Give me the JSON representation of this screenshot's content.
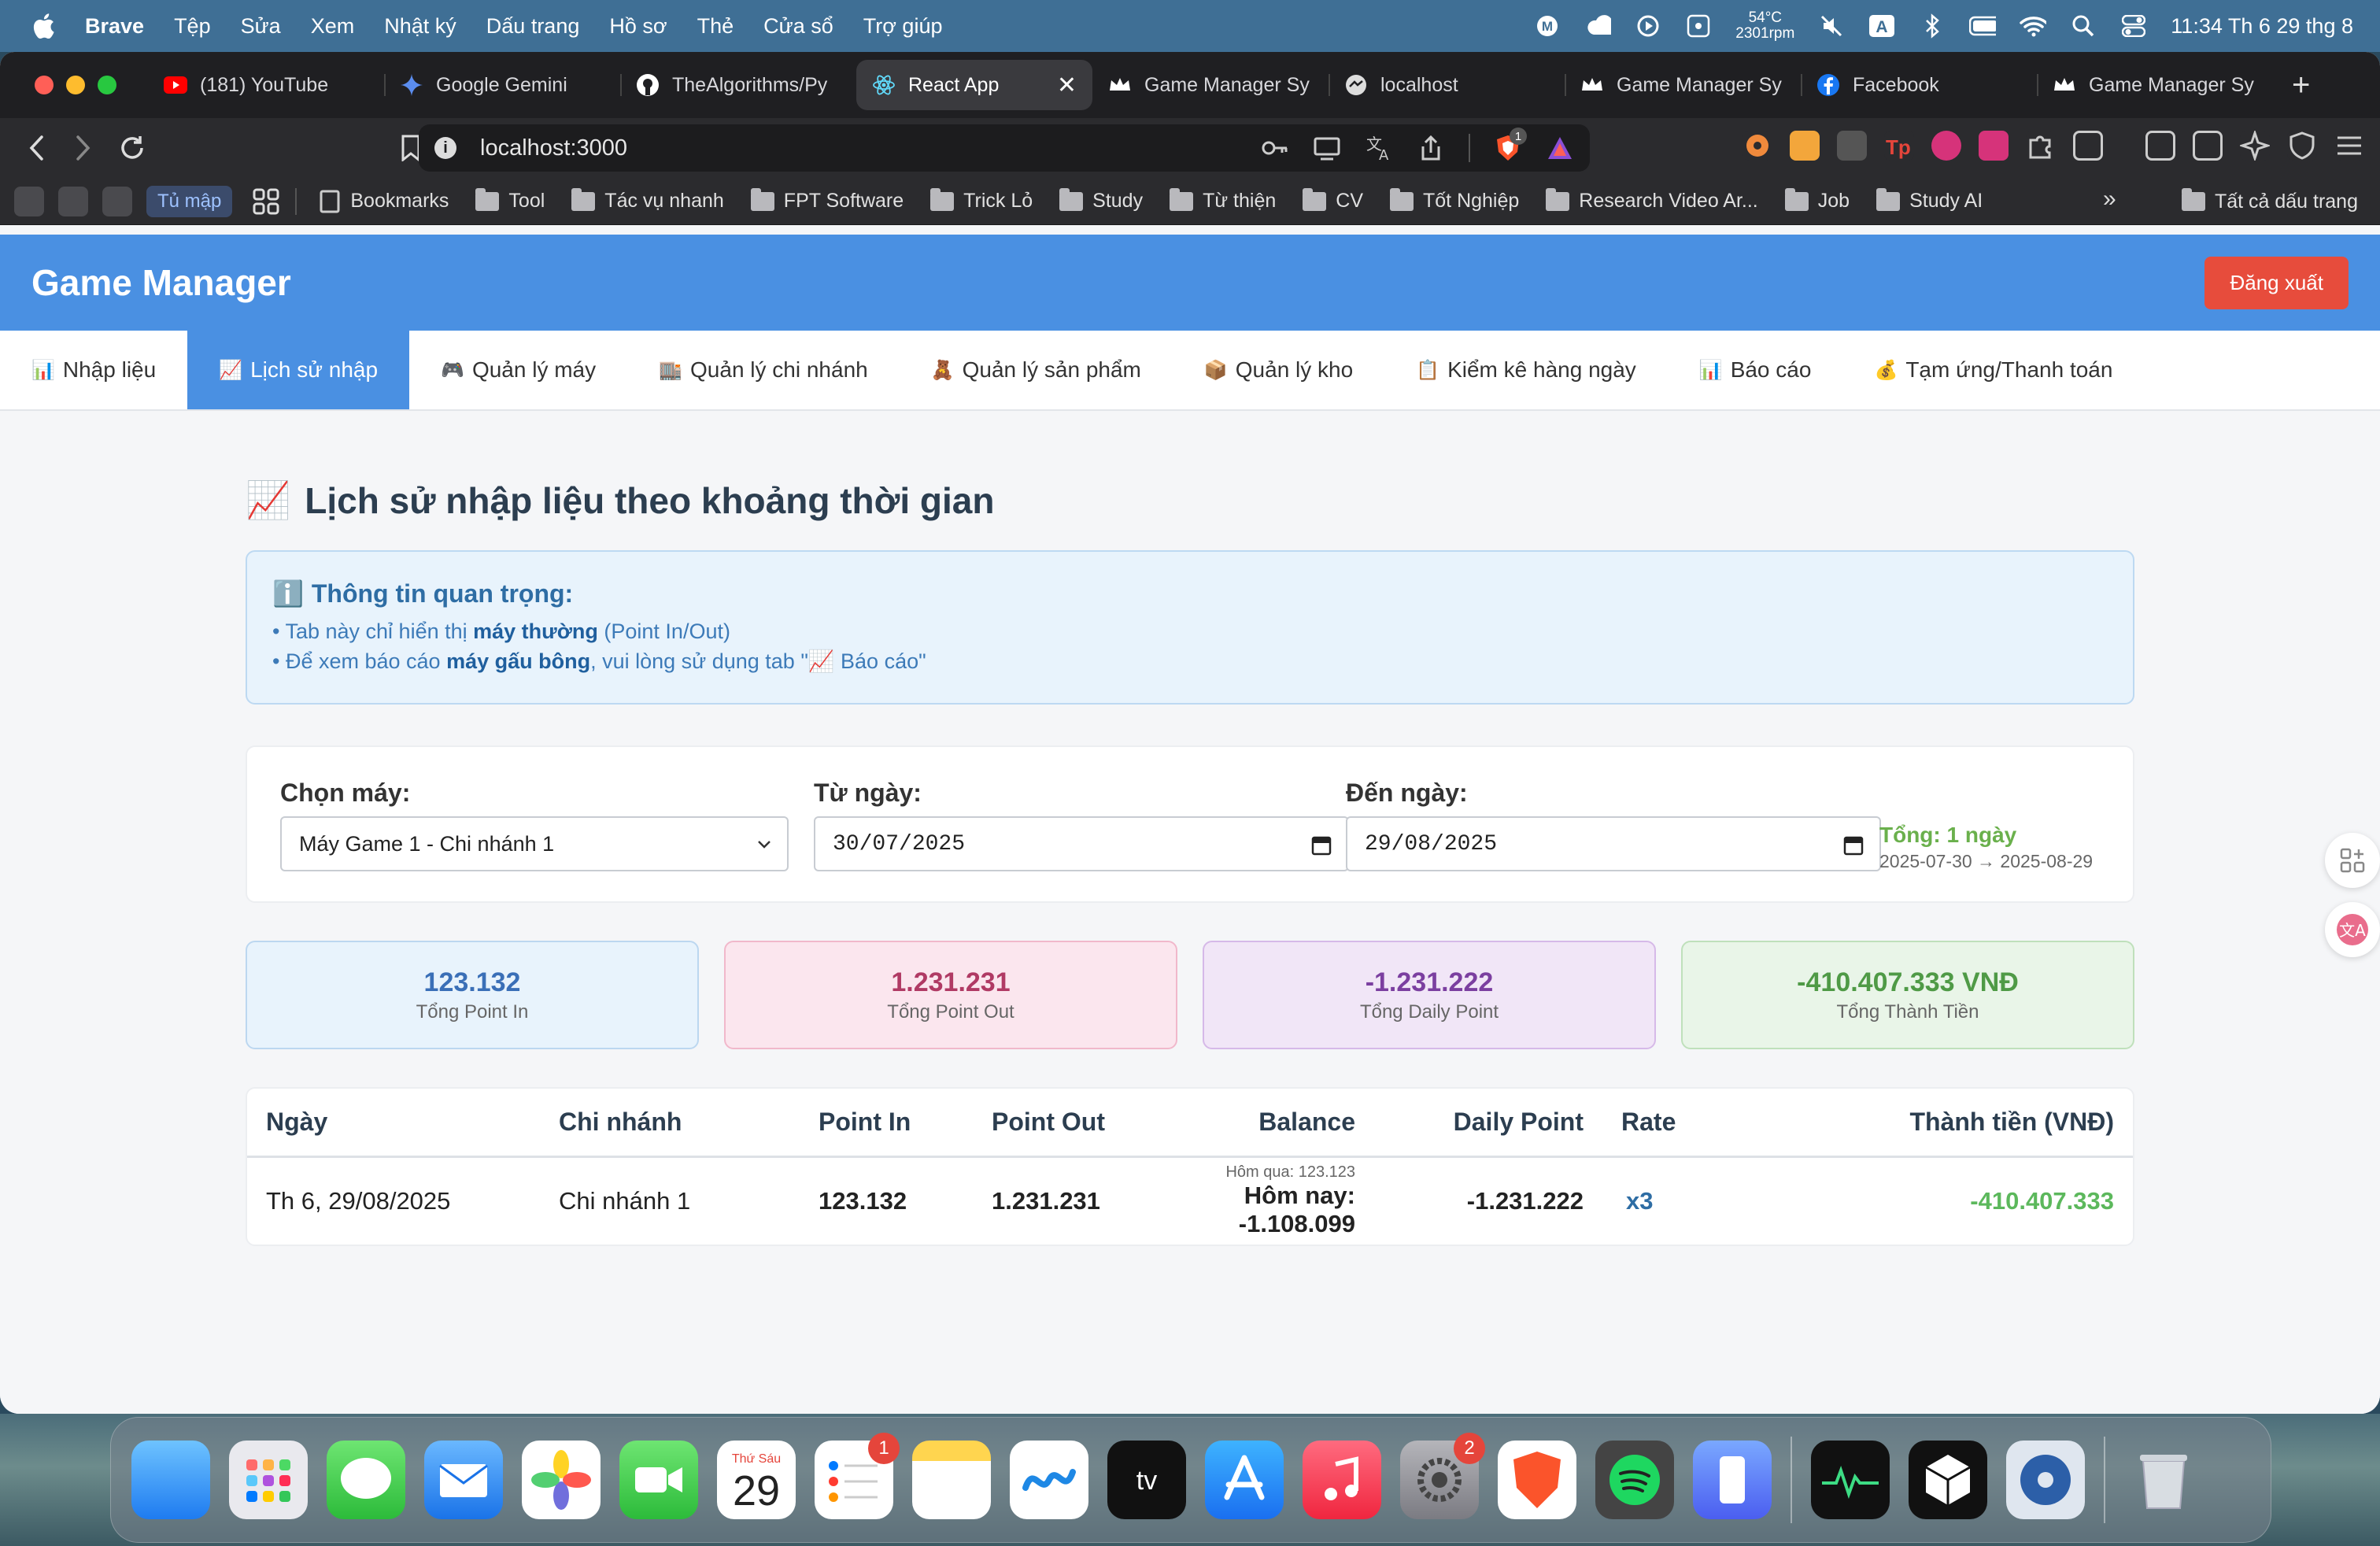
{
  "menubar": {
    "app": "Brave",
    "items": [
      "Tệp",
      "Sửa",
      "Xem",
      "Nhật ký",
      "Dấu trang",
      "Hồ sơ",
      "Thẻ",
      "Cửa sổ",
      "Trợ giúp"
    ],
    "temp": "54°C",
    "rpm": "2301rpm",
    "input_mode": "A",
    "clock": "11:34 Th 6 29 thg 8"
  },
  "browser": {
    "tabs": [
      {
        "label": "(181) YouTube",
        "icon": "youtube-icon",
        "color": "#ff0000"
      },
      {
        "label": "Google Gemini",
        "icon": "gemini-icon",
        "color": "#5b8def"
      },
      {
        "label": "TheAlgorithms/Py",
        "icon": "github-icon",
        "color": "#ffffff"
      },
      {
        "label": "React App",
        "icon": "react-icon",
        "color": "#61dafb",
        "active": true
      },
      {
        "label": "Game Manager Sy",
        "icon": "crown-icon",
        "color": "#ffffff"
      },
      {
        "label": "localhost",
        "icon": "globe-icon",
        "color": "#ffffff"
      },
      {
        "label": "Game Manager Sy",
        "icon": "crown-icon",
        "color": "#ffffff"
      },
      {
        "label": "Facebook",
        "icon": "facebook-icon",
        "color": "#1877f2"
      },
      {
        "label": "Game Manager Sy",
        "icon": "crown-icon",
        "color": "#ffffff"
      }
    ],
    "url": "localhost:3000",
    "shield_count": "1",
    "bookmarks": {
      "tumap": "Tủ mập",
      "items": [
        "Bookmarks",
        "Tool",
        "Tác vụ nhanh",
        "FPT Software",
        "Trick Lỏ",
        "Study",
        "Từ thiện",
        "CV",
        "Tốt Nghiệp",
        "Research Video Ar...",
        "Job",
        "Study AI"
      ],
      "more": "»",
      "all": "Tất cả dấu trang"
    }
  },
  "app": {
    "brand": "Game Manager",
    "logout": "Đăng xuất",
    "colors": {
      "primary": "#4a90e2",
      "danger": "#e74c3c",
      "success": "#5cb85c"
    },
    "tabs": [
      {
        "icon": "📊",
        "label": "Nhập liệu"
      },
      {
        "icon": "📈",
        "label": "Lịch sử nhập",
        "active": true
      },
      {
        "icon": "🎮",
        "label": "Quản lý máy"
      },
      {
        "icon": "🏬",
        "label": "Quản lý chi nhánh"
      },
      {
        "icon": "🧸",
        "label": "Quản lý sản phẩm"
      },
      {
        "icon": "📦",
        "label": "Quản lý kho"
      },
      {
        "icon": "📋",
        "label": "Kiểm kê hàng ngày"
      },
      {
        "icon": "📊",
        "label": "Báo cáo"
      },
      {
        "icon": "💰",
        "label": "Tạm ứng/Thanh toán"
      }
    ]
  },
  "page": {
    "title_icon": "📈",
    "title": "Lịch sử nhập liệu theo khoảng thời gian",
    "info": {
      "icon": "ℹ️",
      "title": "Thông tin quan trọng:",
      "line1_pre": "• Tab này chỉ hiển thị ",
      "line1_bold": "máy thường",
      "line1_post": " (Point In/Out)",
      "line2_pre": "• Để xem báo cáo ",
      "line2_bold": "máy gấu bông",
      "line2_post": ", vui lòng sử dụng tab \"📈 Báo cáo\""
    },
    "filters": {
      "machine_label": "Chọn máy:",
      "machine_value": "Máy Game 1 - Chi nhánh 1",
      "from_label": "Từ ngày:",
      "from_value": "30/07/2025",
      "to_label": "Đến ngày:",
      "to_value": "29/08/2025",
      "total": "Tổng: 1 ngày",
      "range": "2025-07-30 → 2025-08-29"
    },
    "stats": [
      {
        "value": "123.132",
        "label": "Tổng Point In",
        "color": "#3a6fb7",
        "bg": "#e8f3fc",
        "border": "#bcd7f0"
      },
      {
        "value": "1.231.231",
        "label": "Tổng Point Out",
        "color": "#b03a64",
        "bg": "#fbe6ee",
        "border": "#f1b8cb"
      },
      {
        "value": "-1.231.222",
        "label": "Tổng Daily Point",
        "color": "#7b3fa0",
        "bg": "#f1e6f7",
        "border": "#d6b9e8"
      },
      {
        "value": "-410.407.333 VNĐ",
        "label": "Tổng Thành Tiền",
        "color": "#4f9a46",
        "bg": "#e9f5e8",
        "border": "#bfe0bb"
      }
    ],
    "table": {
      "headers": {
        "date": "Ngày",
        "branch": "Chi nhánh",
        "point_in": "Point In",
        "point_out": "Point Out",
        "balance": "Balance",
        "daily": "Daily Point",
        "rate": "Rate",
        "amount": "Thành tiền (VNĐ)"
      },
      "rows": [
        {
          "date": "Th 6, 29/08/2025",
          "branch": "Chi nhánh 1",
          "point_in": "123.132",
          "point_out": "1.231.231",
          "balance_prev": "Hôm qua: 123.123",
          "balance_today": "Hôm nay: -1.108.099",
          "daily": "-1.231.222",
          "rate": "x3",
          "amount": "-410.407.333"
        }
      ]
    }
  },
  "dock": {
    "calendar_day": "Thứ Sáu",
    "calendar_date": "29",
    "reminders_badge": "1",
    "settings_badge": "2",
    "tv_label": "tv"
  }
}
